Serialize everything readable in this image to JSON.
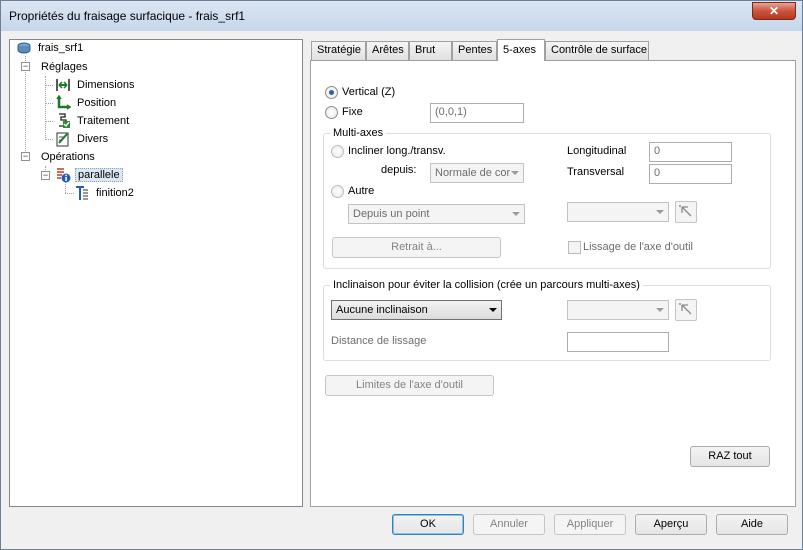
{
  "window": {
    "title": "Propriétés du fraisage surfacique - frais_srf1",
    "close_glyph": "✕"
  },
  "tree": {
    "root": "frais_srf1",
    "settings": "Réglages",
    "settings_items": [
      "Dimensions",
      "Position",
      "Traitement",
      "Divers"
    ],
    "operations": "Opérations",
    "operation": "parallele",
    "sub_operation": "finition2",
    "expander_minus": "−"
  },
  "tabs": [
    "Stratégie",
    "Arêtes",
    "Brut",
    "Pentes",
    "5-axes",
    "Contrôle de surface"
  ],
  "active_tab": "5-axes",
  "axis": {
    "vertical_label": "Vertical (Z)",
    "fixed_label": "Fixe",
    "fixed_value": "(0,0,1)"
  },
  "multiaxes": {
    "title": "Multi-axes",
    "tilt_label": "Incliner long./transv.",
    "from_label": "depuis:",
    "from_value": "Normale de cor",
    "longitudinal_label": "Longitudinal",
    "longitudinal_value": "0",
    "transversal_label": "Transversal",
    "transversal_value": "0",
    "other_label": "Autre",
    "other_value": "Depuis un point",
    "other_combo_value": "",
    "retract_button": "Retrait à...",
    "smoothing_label": "Lissage de l'axe d'outil"
  },
  "collision": {
    "title": "Inclinaison pour éviter la collision (crée un parcours multi-axes)",
    "mode_value": "Aucune inclinaison",
    "second_combo_value": "",
    "smoothing_distance_label": "Distance de lissage",
    "smoothing_distance_value": ""
  },
  "limits_button": "Limites de l'axe d'outil",
  "reset_button": "RAZ tout",
  "footer": {
    "ok": "OK",
    "cancel": "Annuler",
    "apply": "Appliquer",
    "preview": "Aperçu",
    "help": "Aide"
  }
}
